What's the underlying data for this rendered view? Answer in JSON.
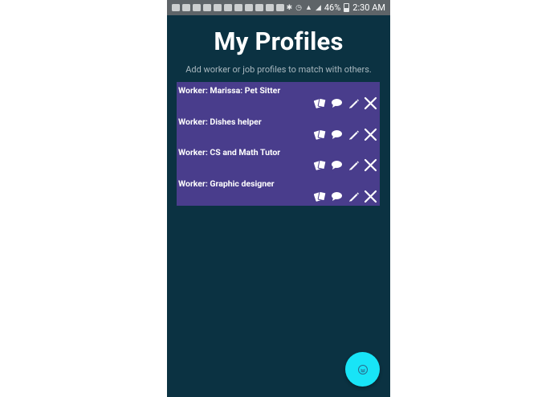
{
  "status_bar": {
    "battery": "46%",
    "time": "2:30 AM",
    "notification_icons": [
      "message-icon",
      "flipboard-icon",
      "facebook-icon",
      "facebook-icon",
      "cloud-icon",
      "pinterest-icon",
      "image-icon",
      "download-icon",
      "calendar-icon",
      "instagram-icon",
      "amazon-icon"
    ],
    "system_icons": [
      "bluetooth-icon",
      "alarm-icon",
      "wifi-icon",
      "signal-icon",
      "battery-icon"
    ]
  },
  "page": {
    "title": "My Profiles",
    "subtitle": "Add worker or job profiles to match with others."
  },
  "profiles": [
    {
      "label": "Worker: Marissa: Pet Sitter"
    },
    {
      "label": "Worker: Dishes helper"
    },
    {
      "label": "Worker: CS and Math Tutor"
    },
    {
      "label": "Worker: Graphic designer"
    }
  ],
  "row_actions": [
    "cards-icon",
    "chat-icon",
    "edit-icon",
    "delete-icon"
  ],
  "colors": {
    "background": "#0b3242",
    "list_background": "#493d8c",
    "fab": "#18e4f7",
    "status_bar": "#5e6468"
  }
}
